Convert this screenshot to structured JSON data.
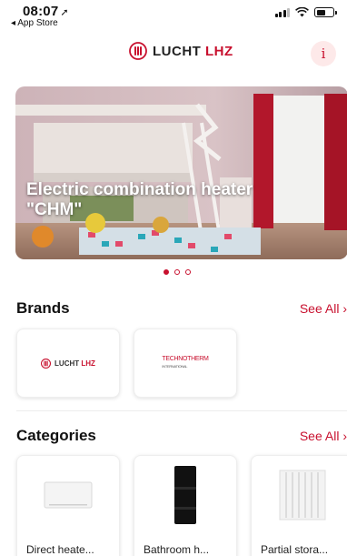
{
  "status_bar": {
    "time": "08:07",
    "back_label": "◂ App Store"
  },
  "header": {
    "logo_brand": "LUCHT",
    "logo_suffix": "LHZ",
    "info_label": "i",
    "accent_color": "#c8102e"
  },
  "banner": {
    "caption": "Electric combination heater \"CHM\"",
    "slide_count": 3,
    "active_slide": 1
  },
  "brands": {
    "title": "Brands",
    "see_all": "See All",
    "items": [
      {
        "name": "LUCHT LHZ",
        "logo_part1": "LUCHT",
        "logo_part2": "LHZ"
      },
      {
        "name": "TECHNOTHERM",
        "logo_text": "TECHNOTHERM",
        "logo_sub": "INTERNATIONAL"
      }
    ]
  },
  "categories": {
    "title": "Categories",
    "see_all": "See All",
    "items": [
      {
        "label": "Direct heate...",
        "icon": "panel-heater-icon"
      },
      {
        "label": "Bathroom h...",
        "icon": "towel-heater-icon"
      },
      {
        "label": "Partial stora...",
        "icon": "storage-heater-icon"
      }
    ]
  }
}
